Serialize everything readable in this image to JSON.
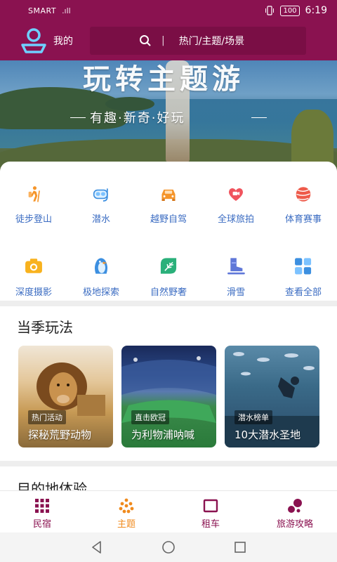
{
  "status_bar": {
    "carrier": "SMART",
    "signal": ".ıll",
    "battery": "100",
    "time": "6:19"
  },
  "header": {
    "mine_label": "我的",
    "divider": "|",
    "search_placeholder": "热门/主题/场景"
  },
  "banner": {
    "title": "玩转主题游",
    "subtitle": "有趣·新奇·好玩"
  },
  "categories": [
    {
      "label": "徒步登山",
      "icon": "hiking-icon"
    },
    {
      "label": "潜水",
      "icon": "diving-mask-icon"
    },
    {
      "label": "越野自驾",
      "icon": "car-icon"
    },
    {
      "label": "全球旅拍",
      "icon": "heart-camera-icon"
    },
    {
      "label": "体育赛事",
      "icon": "ball-icon"
    },
    {
      "label": "深度摄影",
      "icon": "camera-icon"
    },
    {
      "label": "极地探索",
      "icon": "penguin-icon"
    },
    {
      "label": "自然野奢",
      "icon": "leaf-icon"
    },
    {
      "label": "滑雪",
      "icon": "ski-boot-icon"
    },
    {
      "label": "查看全部",
      "icon": "grid-icon"
    }
  ],
  "season": {
    "title": "当季玩法",
    "cards": [
      {
        "tag": "热门活动",
        "title": "探秘荒野动物"
      },
      {
        "tag": "直击欧冠",
        "title": "为利物浦呐喊"
      },
      {
        "tag": "潜水榜单",
        "title": "10大潜水圣地"
      }
    ]
  },
  "destination": {
    "title": "目的地体验"
  },
  "bottom_nav": [
    {
      "label": "民宿",
      "icon": "grid-dots-icon"
    },
    {
      "label": "主题",
      "icon": "theme-dots-icon",
      "active": true
    },
    {
      "label": "租车",
      "icon": "square-icon"
    },
    {
      "label": "旅游攻略",
      "icon": "bubbles-icon"
    }
  ],
  "colors": {
    "brand": "#8a1250",
    "accent": "#f08a1c",
    "link": "#3b6cc2"
  }
}
